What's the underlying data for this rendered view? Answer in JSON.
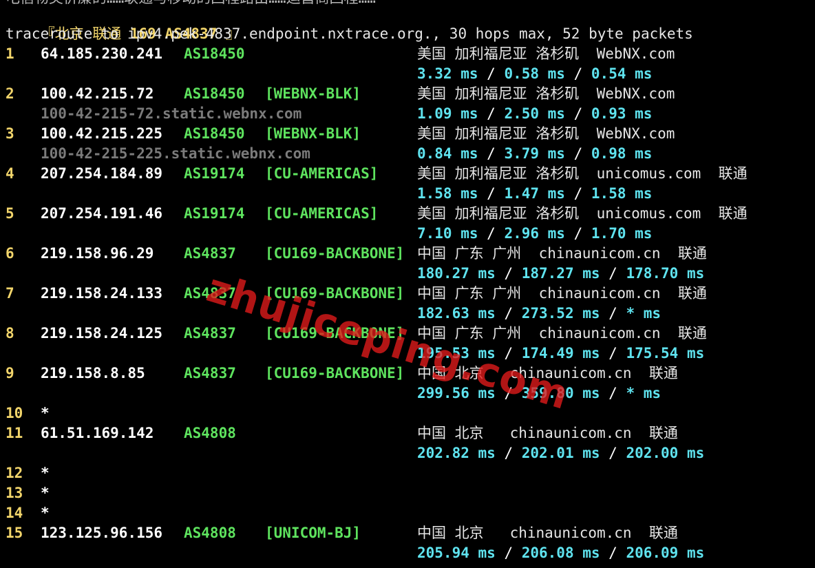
{
  "top_partial": "电信物美价廉的……联通与移动的回程路由……运营商回程……",
  "header": {
    "open_bracket": "『",
    "city": "北京",
    "isp": "联通",
    "route": "169",
    "asn": "AS4837",
    "close_bracket": "』"
  },
  "command_line": "traceroute to ipv4.pek-4837.endpoint.nxtrace.org., 30 hops max, 52 byte packets",
  "watermark": "zhujiceping.com",
  "colors": {
    "hop_number": "#f2d56b",
    "ip": "#ffffff",
    "asn": "#5ee35e",
    "rdns": "#7b7b7b",
    "rtt": "#5fe3ef",
    "watermark": "#e31b1b",
    "background": "#000000"
  },
  "hops": [
    {
      "no": "1",
      "ip": "64.185.230.241",
      "asn": "AS18450",
      "tag": "",
      "geo": "美国 加利福尼亚 洛杉矶  WebNX.com",
      "rdns": "",
      "rtt": [
        "3.32 ms",
        "0.58 ms",
        "0.54 ms"
      ]
    },
    {
      "no": "2",
      "ip": "100.42.215.72",
      "asn": "AS18450",
      "tag": "[WEBNX-BLK]",
      "geo": "美国 加利福尼亚 洛杉矶  WebNX.com",
      "rdns": "100-42-215-72.static.webnx.com",
      "rtt": [
        "1.09 ms",
        "2.50 ms",
        "0.93 ms"
      ]
    },
    {
      "no": "3",
      "ip": "100.42.215.225",
      "asn": "AS18450",
      "tag": "[WEBNX-BLK]",
      "geo": "美国 加利福尼亚 洛杉矶  WebNX.com",
      "rdns": "100-42-215-225.static.webnx.com",
      "rtt": [
        "0.84 ms",
        "3.79 ms",
        "0.98 ms"
      ]
    },
    {
      "no": "4",
      "ip": "207.254.184.89",
      "asn": "AS19174",
      "tag": "[CU-AMERICAS]",
      "geo": "美国 加利福尼亚 洛杉矶  unicomus.com  联通",
      "rdns": "",
      "rtt": [
        "1.58 ms",
        "1.47 ms",
        "1.58 ms"
      ]
    },
    {
      "no": "5",
      "ip": "207.254.191.46",
      "asn": "AS19174",
      "tag": "[CU-AMERICAS]",
      "geo": "美国 加利福尼亚 洛杉矶  unicomus.com  联通",
      "rdns": "",
      "rtt": [
        "7.10 ms",
        "2.96 ms",
        "1.70 ms"
      ]
    },
    {
      "no": "6",
      "ip": "219.158.96.29",
      "asn": "AS4837",
      "tag": "[CU169-BACKBONE]",
      "geo": "中国 广东 广州  chinaunicom.cn  联通",
      "rdns": "",
      "rtt": [
        "180.27 ms",
        "187.27 ms",
        "178.70 ms"
      ]
    },
    {
      "no": "7",
      "ip": "219.158.24.133",
      "asn": "AS4837",
      "tag": "[CU169-BACKBONE]",
      "geo": "中国 广东 广州  chinaunicom.cn  联通",
      "rdns": "",
      "rtt": [
        "182.63 ms",
        "273.52 ms",
        "* ms"
      ]
    },
    {
      "no": "8",
      "ip": "219.158.24.125",
      "asn": "AS4837",
      "tag": "[CU169-BACKBONE]",
      "geo": "中国 广东 广州  chinaunicom.cn  联通",
      "rdns": "",
      "rtt": [
        "195.53 ms",
        "174.49 ms",
        "175.54 ms"
      ]
    },
    {
      "no": "9",
      "ip": "219.158.8.85",
      "asn": "AS4837",
      "tag": "[CU169-BACKBONE]",
      "geo": "中国 北京   chinaunicom.cn  联通",
      "rdns": "",
      "rtt": [
        "299.56 ms",
        "359.80 ms",
        "* ms"
      ]
    },
    {
      "no": "10",
      "star": "*"
    },
    {
      "no": "11",
      "ip": "61.51.169.142",
      "asn": "AS4808",
      "tag": "",
      "geo": "中国 北京   chinaunicom.cn  联通",
      "rdns": "",
      "rtt": [
        "202.82 ms",
        "202.01 ms",
        "202.00 ms"
      ]
    },
    {
      "no": "12",
      "star": "*"
    },
    {
      "no": "13",
      "star": "*"
    },
    {
      "no": "14",
      "star": "*"
    },
    {
      "no": "15",
      "ip": "123.125.96.156",
      "asn": "AS4808",
      "tag": "[UNICOM-BJ]",
      "geo": "中国 北京   chinaunicom.cn  联通",
      "rdns": "",
      "rtt": [
        "205.94 ms",
        "206.08 ms",
        "206.09 ms"
      ]
    }
  ]
}
